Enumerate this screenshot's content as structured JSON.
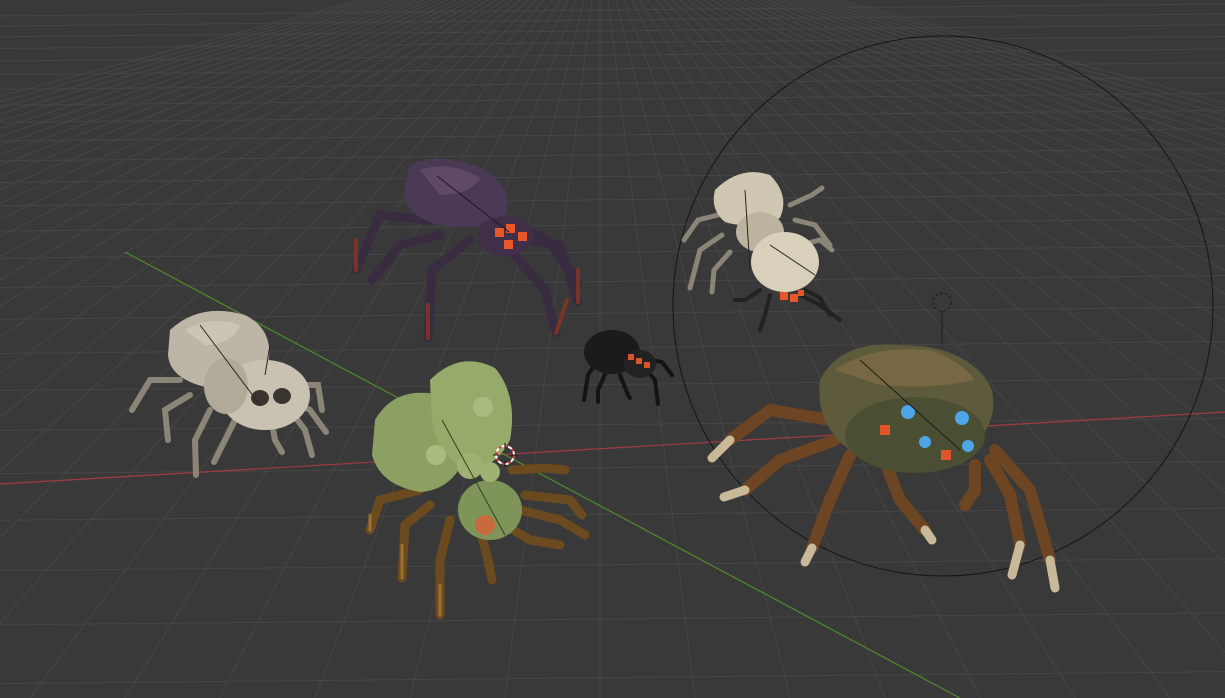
{
  "viewport": {
    "view": "3d-viewport",
    "background_color": "#393939",
    "grid_line_color": "#464646",
    "x_axis_color": "#a23a45",
    "y_axis_color": "#4f8a2c",
    "empty_circle_color": "#111111",
    "objects": [
      {
        "name": "purple-spider",
        "body_color": "#4b3a55",
        "eye_color": "#e8562a"
      },
      {
        "name": "pale-skull-spider-left",
        "body_color": "#bdb6a6",
        "eye_color": "#3a3530"
      },
      {
        "name": "pale-skull-spider-right",
        "body_color": "#cfc7b2",
        "eye_color": "#e8562a"
      },
      {
        "name": "black-spider",
        "body_color": "#1b1b1b",
        "eye_color": "#d8542b"
      },
      {
        "name": "green-spider",
        "body_color": "#8ca064",
        "eye_color": "#d3633a"
      },
      {
        "name": "furry-brown-spider",
        "body_color": "#5e5a3c",
        "eye_color": "#4fa6e6"
      }
    ]
  }
}
